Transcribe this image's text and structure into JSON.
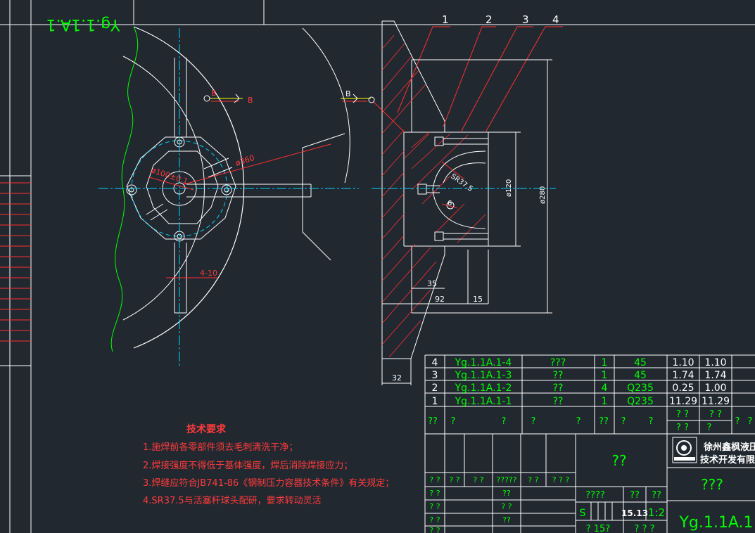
{
  "sheet": {
    "rotated_title": "Yg.1.1A.1",
    "background": "#212830",
    "line_color": "#ffffff",
    "center_line_color": "#00d8ff",
    "hatch_color": "#ff3030",
    "text_color": "#00ff00",
    "note_color": "#ff3b3b"
  },
  "front_view": {
    "section_mark": "B",
    "dim_diameter_360": "ø360",
    "dim_diameter_100": "ø100±0.1",
    "dim_slot": "4-10"
  },
  "section_view": {
    "section_mark": "B",
    "balloons": [
      "1",
      "2",
      "3",
      "4"
    ],
    "dim_sr": "SR37.5",
    "dim_small": "6",
    "dim_120": "ø120",
    "dim_280": "ø280",
    "dim_35": "35",
    "dim_92": "92",
    "dim_15": "15",
    "dim_32": "32"
  },
  "bom": {
    "rows": [
      {
        "no": "4",
        "code": "Yg.1.1A.1-4",
        "name": "???",
        "qty": "1",
        "material": "45",
        "unit_weight": "1.10",
        "total_weight": "1.10"
      },
      {
        "no": "3",
        "code": "Yg.1.1A.1-3",
        "name": "??",
        "qty": "1",
        "material": "45",
        "unit_weight": "1.74",
        "total_weight": "1.74"
      },
      {
        "no": "2",
        "code": "Yg.1.1A.1-2",
        "name": "??",
        "qty": "4",
        "material": "Q235",
        "unit_weight": "0.25",
        "total_weight": "1.00"
      },
      {
        "no": "1",
        "code": "Yg.1.1A.1-1",
        "name": "??",
        "qty": "1",
        "material": "Q235",
        "unit_weight": "11.29",
        "total_weight": "11.29"
      }
    ],
    "header": [
      "??",
      "?",
      "?",
      "?",
      "?",
      "??",
      "?",
      "?",
      "? ?",
      "? ?",
      "?",
      "?",
      "? ?",
      "?"
    ]
  },
  "title_block": {
    "drawing_name": "??",
    "company_line1": "徐州鑫枫液压",
    "company_line2": "技术开发有限公司",
    "material_mark": "???",
    "drawing_code": "Yg.1.1A.1",
    "weight": "15.13",
    "scale": "1:2",
    "stage_label": "????",
    "s_label": "S",
    "weight_hdr": "??",
    "scale_hdr": "??",
    "sheet_info": "? 15?",
    "sheet_info2": "? ? ?",
    "rev_row": [
      "? ?",
      "? ?",
      "? ?",
      "?????",
      "? ?",
      "? ? ?"
    ],
    "sign_rows": [
      [
        "? ?",
        "??"
      ],
      [
        "? ?",
        "? ?"
      ],
      [
        "? ?",
        "??"
      ],
      [
        "? ?",
        ""
      ]
    ]
  },
  "notes": {
    "title": "技术要求",
    "items": [
      "1.施焊前各零部件须去毛刺清洗干净；",
      "2.焊接强度不得低于基体强度，焊后消除焊接应力；",
      "3.焊缝应符合JB741-86《钢制压力容器技术条件》有关规定；",
      "4.SR37.5与活塞杆球头配研，要求转动灵活"
    ]
  }
}
